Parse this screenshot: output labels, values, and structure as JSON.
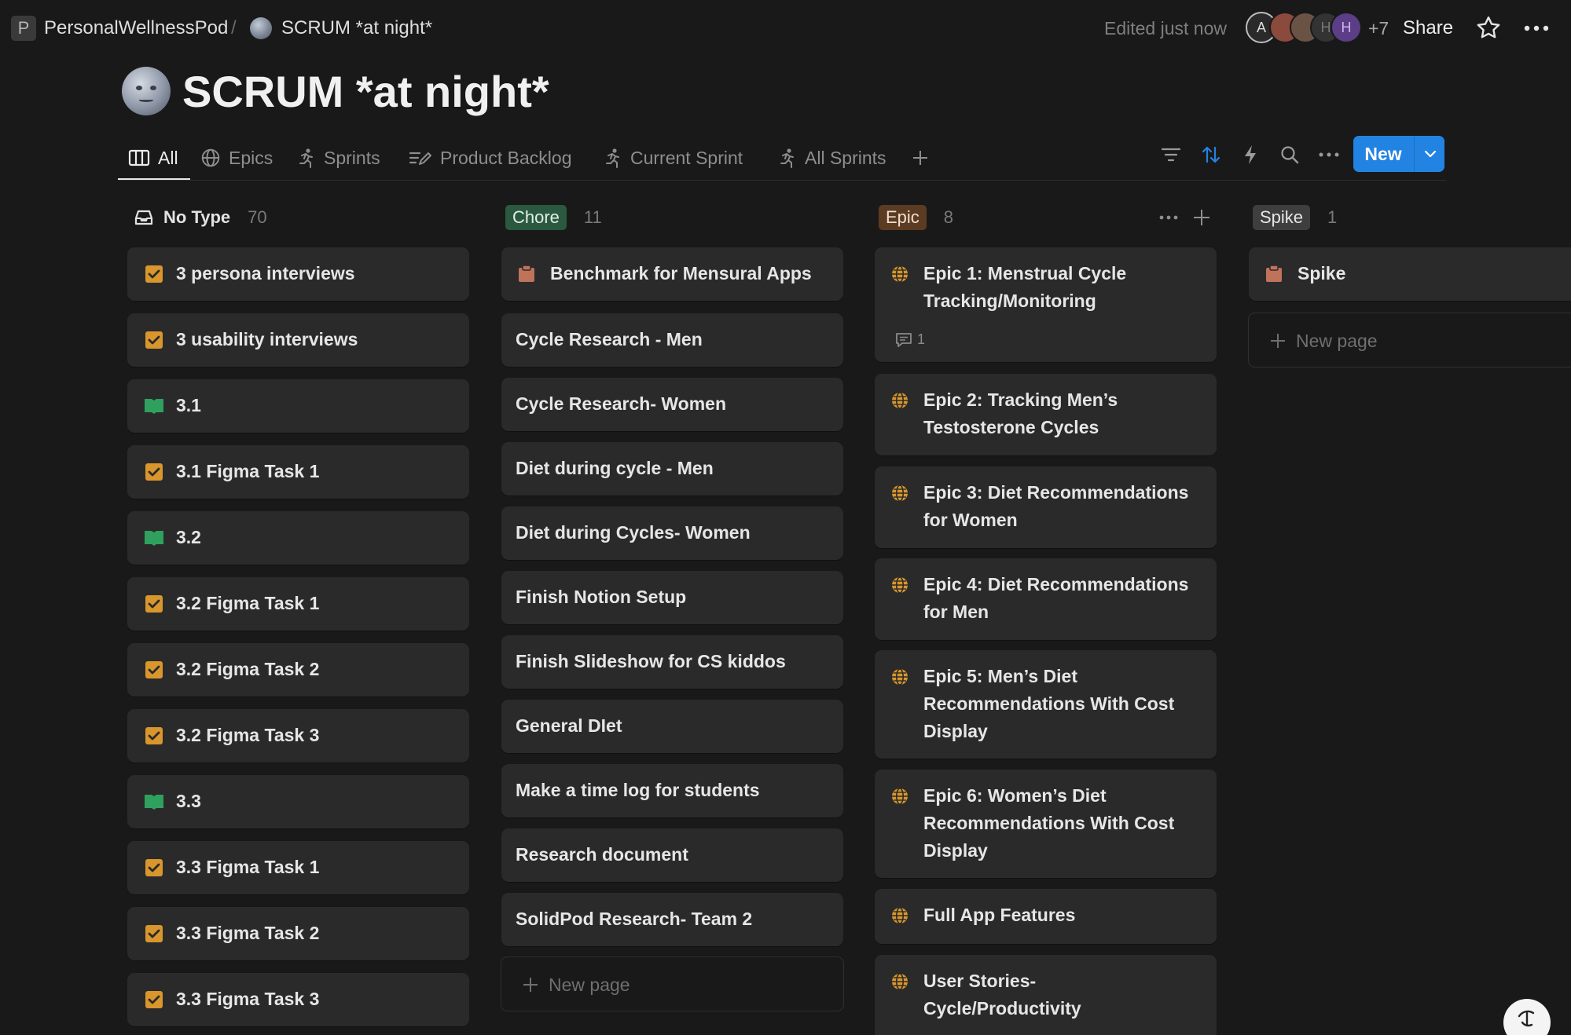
{
  "breadcrumb": {
    "workspace_initial": "P",
    "workspace": "PersonalWellnessPod",
    "separator": "/",
    "page": "SCRUM *at night*"
  },
  "topbar": {
    "edited": "Edited just now",
    "avatars": [
      {
        "initial": "A",
        "color": "#3a3a3a"
      },
      {
        "initial": "",
        "color": "#8a4a3c"
      },
      {
        "initial": "",
        "color": "#6a5344"
      },
      {
        "initial": "H",
        "color": "#333333"
      },
      {
        "initial": "H",
        "color": "#5b3e86"
      }
    ],
    "more_users": "+7",
    "share": "Share"
  },
  "page": {
    "title": "SCRUM *at night*",
    "icon": "moon-face-icon"
  },
  "tabs": [
    {
      "label": "All",
      "icon": "board-icon"
    },
    {
      "label": "Epics",
      "icon": "globe-icon"
    },
    {
      "label": "Sprints",
      "icon": "runner-icon"
    },
    {
      "label": "Product Backlog",
      "icon": "list-edit-icon"
    },
    {
      "label": "Current Sprint",
      "icon": "runner-icon"
    },
    {
      "label": "All Sprints",
      "icon": "runner-icon"
    }
  ],
  "toolbar": {
    "new_label": "New"
  },
  "accent": "#2383e2",
  "columns": [
    {
      "name": "No Type",
      "count": "70",
      "tag": "none",
      "cards": [
        {
          "title": "3 persona interviews",
          "icon": "checkbox-icon"
        },
        {
          "title": "3 usability interviews",
          "icon": "checkbox-icon"
        },
        {
          "title": "3.1",
          "icon": "book-icon"
        },
        {
          "title": "3.1 Figma Task 1",
          "icon": "checkbox-icon"
        },
        {
          "title": "3.2",
          "icon": "book-icon"
        },
        {
          "title": "3.2 Figma Task 1",
          "icon": "checkbox-icon"
        },
        {
          "title": "3.2 Figma Task 2",
          "icon": "checkbox-icon"
        },
        {
          "title": "3.2 Figma Task 3",
          "icon": "checkbox-icon"
        },
        {
          "title": "3.3",
          "icon": "book-icon"
        },
        {
          "title": "3.3 Figma Task 1",
          "icon": "checkbox-icon"
        },
        {
          "title": "3.3 Figma Task 2",
          "icon": "checkbox-icon"
        },
        {
          "title": "3.3 Figma Task 3",
          "icon": "checkbox-icon"
        }
      ]
    },
    {
      "name": "Chore",
      "count": "11",
      "tag": "chore",
      "cards": [
        {
          "title": "Benchmark for Mensural Apps",
          "icon": "clipboard-icon"
        },
        {
          "title": "Cycle Research - Men",
          "icon": ""
        },
        {
          "title": "Cycle Research- Women",
          "icon": ""
        },
        {
          "title": "Diet during cycle - Men",
          "icon": ""
        },
        {
          "title": "Diet during Cycles- Women",
          "icon": ""
        },
        {
          "title": "Finish Notion Setup",
          "icon": ""
        },
        {
          "title": "Finish Slideshow for CS kiddos",
          "icon": ""
        },
        {
          "title": "General DIet",
          "icon": ""
        },
        {
          "title": "Make a time log for students",
          "icon": ""
        },
        {
          "title": "Research document",
          "icon": ""
        },
        {
          "title": "SolidPod Research- Team 2",
          "icon": ""
        }
      ],
      "new_page": "New page"
    },
    {
      "name": "Epic",
      "count": "8",
      "tag": "epic",
      "cards": [
        {
          "title_lines": [
            "Epic 1: Menstrual Cycle",
            "Tracking/Monitoring"
          ],
          "comments": "1"
        },
        {
          "title_lines": [
            "Epic 2: Tracking Men’s",
            "Testosterone Cycles"
          ]
        },
        {
          "title_lines": [
            "Epic 3: Diet Recommendations",
            "for Women"
          ]
        },
        {
          "title_lines": [
            "Epic 4: Diet Recommendations",
            "for Men"
          ]
        },
        {
          "title_lines": [
            "Epic 5: Men’s Diet",
            "Recommendations With Cost",
            "Display"
          ]
        },
        {
          "title_lines": [
            "Epic 6: Women’s Diet",
            "Recommendations With Cost",
            "Display"
          ]
        },
        {
          "title_lines": [
            "Full App Features"
          ]
        },
        {
          "title_lines": [
            "User Stories-",
            "Cycle/Productivity"
          ]
        }
      ]
    },
    {
      "name": "Spike",
      "count": "1",
      "tag": "spike",
      "cards": [
        {
          "title": "Spike",
          "icon": "clipboard-icon"
        }
      ],
      "new_page": "New page"
    }
  ]
}
